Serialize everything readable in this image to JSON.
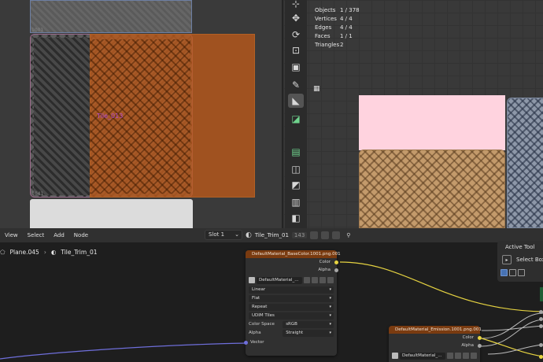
{
  "uv_editor": {
    "tile_label": "Tile_013",
    "tile_number_top": "1001",
    "tile_number_bottom": "1041"
  },
  "viewport": {
    "stats": [
      {
        "key": "Objects",
        "value": "1 / 378"
      },
      {
        "key": "Vertices",
        "value": "4 / 4"
      },
      {
        "key": "Edges",
        "value": "4 / 4"
      },
      {
        "key": "Faces",
        "value": "1 / 1"
      },
      {
        "key": "Triangles",
        "value": "2"
      }
    ]
  },
  "node_header": {
    "menu": [
      "View",
      "Select",
      "Add",
      "Node"
    ],
    "slot": "Slot 1",
    "material_name": "Tile_Trim_01",
    "material_users": "143"
  },
  "breadcrumb": {
    "object": "Plane.045",
    "material": "Tile_Trim_01"
  },
  "node_basecolor": {
    "title": "DefaultMaterial_BaseColor.1001.png.001",
    "out_color": "Color",
    "out_alpha": "Alpha",
    "image_name": "DefaultMaterial_...",
    "interpolation": "Linear",
    "projection": "Flat",
    "extension": "Repeat",
    "source": "UDIM Tiles",
    "color_space_label": "Color Space",
    "color_space": "sRGB",
    "alpha_label": "Alpha",
    "alpha_mode": "Straight",
    "in_vector": "Vector"
  },
  "node_emission": {
    "title": "DefaultMaterial_Emission.1001.png.001",
    "out_color": "Color",
    "out_alpha": "Alpha",
    "image_name": "DefaultMaterial_..."
  },
  "active_tool": {
    "panel_title": "Active Tool",
    "tool_name": "Select Box"
  },
  "colors": {
    "node_header": "#7a3b10",
    "socket_color": "#e6d341",
    "socket_vector": "#6f6fdc",
    "socket_float": "#a6a6a6"
  }
}
